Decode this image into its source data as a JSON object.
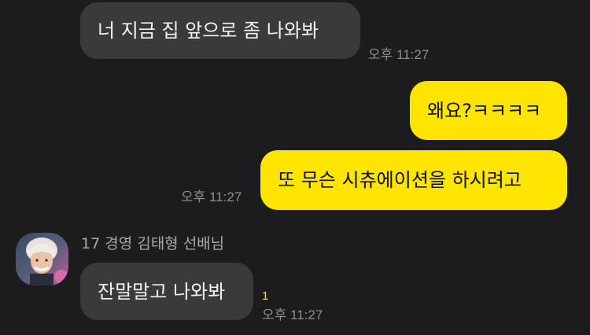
{
  "messages": [
    {
      "text": "너 지금 집 앞으로 좀 나와봐",
      "time": "오후 11:27"
    },
    {
      "text": "왜요?ㅋㅋㅋㅋ"
    },
    {
      "text": "또 무슨 시츄에이션을 하시려고",
      "time": "오후 11:27"
    },
    {
      "sender": "17 경영 김태형 선배님",
      "text": "잔말말고 나와봐",
      "unread": "1",
      "time": "오후 11:27"
    }
  ],
  "colors": {
    "background": "#1c1c1e",
    "incoming_bubble": "#3a3a3c",
    "outgoing_bubble": "#fee500",
    "unread_count": "#fee500"
  },
  "icons": {
    "avatar": "profile-photo"
  }
}
